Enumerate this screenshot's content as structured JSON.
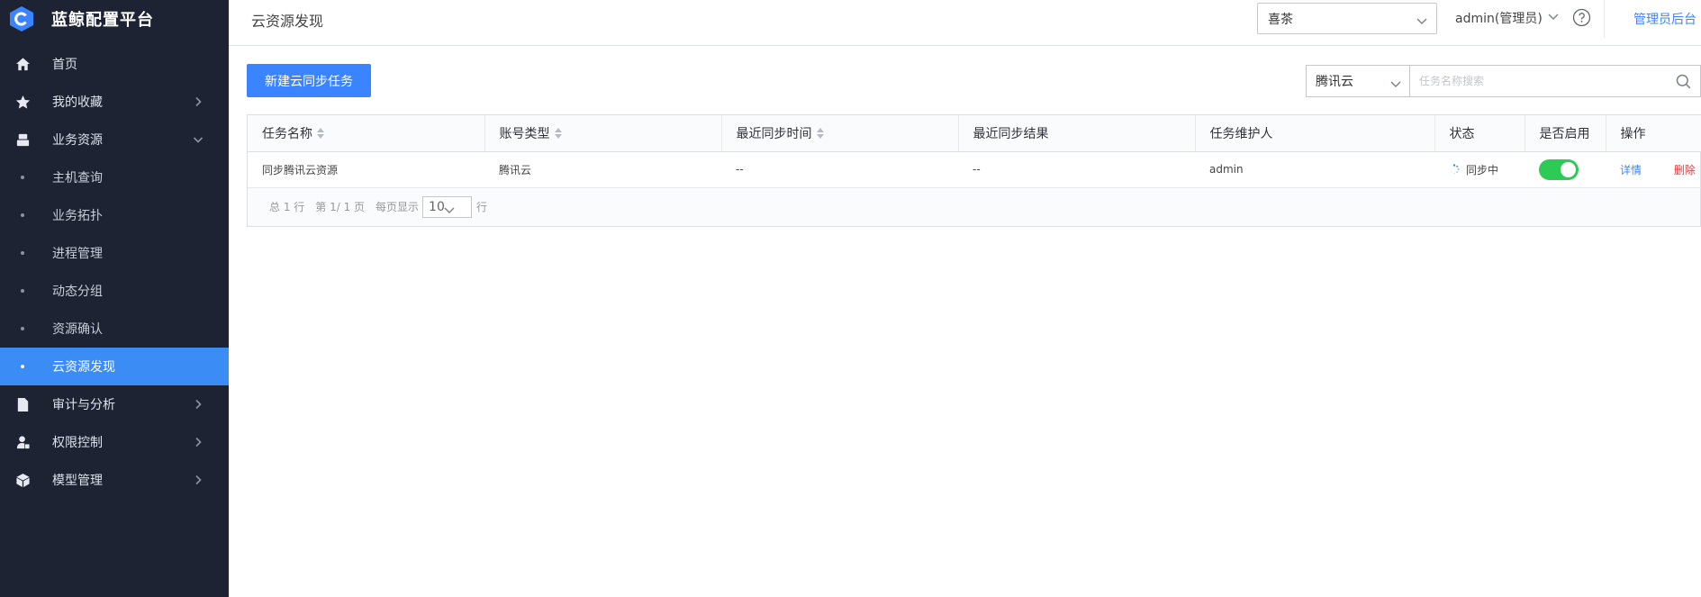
{
  "app": {
    "name": "蓝鲸配置平台"
  },
  "sidebar": {
    "items": [
      {
        "label": "首页",
        "icon": "home-icon",
        "type": "top",
        "arrow": ""
      },
      {
        "label": "我的收藏",
        "icon": "star-icon",
        "type": "top",
        "arrow": "right"
      },
      {
        "label": "业务资源",
        "icon": "business-resource-icon",
        "type": "top",
        "arrow": "down"
      },
      {
        "label": "主机查询",
        "type": "sub"
      },
      {
        "label": "业务拓扑",
        "type": "sub"
      },
      {
        "label": "进程管理",
        "type": "sub"
      },
      {
        "label": "动态分组",
        "type": "sub"
      },
      {
        "label": "资源确认",
        "type": "sub"
      },
      {
        "label": "云资源发现",
        "type": "sub",
        "active": true
      },
      {
        "label": "审计与分析",
        "icon": "audit-icon",
        "type": "top",
        "arrow": "right"
      },
      {
        "label": "权限控制",
        "icon": "permission-icon",
        "type": "top",
        "arrow": "right"
      },
      {
        "label": "模型管理",
        "icon": "model-cube-icon",
        "type": "top",
        "arrow": "right"
      }
    ]
  },
  "header": {
    "title": "云资源发现",
    "business_select": "喜茶",
    "user": "admin(管理员)",
    "admin_link": "管理员后台"
  },
  "toolbar": {
    "new_button": "新建云同步任务",
    "cloud_select": "腾讯云",
    "search_placeholder": "任务名称搜索"
  },
  "table": {
    "columns": [
      "任务名称",
      "账号类型",
      "最近同步时间",
      "最近同步结果",
      "任务维护人",
      "状态",
      "是否启用",
      "操作"
    ],
    "rows": [
      {
        "name": "同步腾讯云资源",
        "account_type": "腾讯云",
        "last_sync_time": "--",
        "last_sync_result": "--",
        "maintainer": "admin",
        "status": "同步中",
        "enabled": true,
        "op_detail": "详情",
        "op_delete": "删除"
      }
    ]
  },
  "pagination": {
    "total": "总 1 行",
    "page": "第 1/ 1 页",
    "per_page_label": "每页显示",
    "per_page_value": "10",
    "unit": "行"
  },
  "colors": {
    "sidebar_bg": "#1d2332",
    "accent": "#3a84ff",
    "active_menu": "#3c8cf6",
    "toggle_on": "#2dcb56",
    "danger": "#ea3636"
  }
}
